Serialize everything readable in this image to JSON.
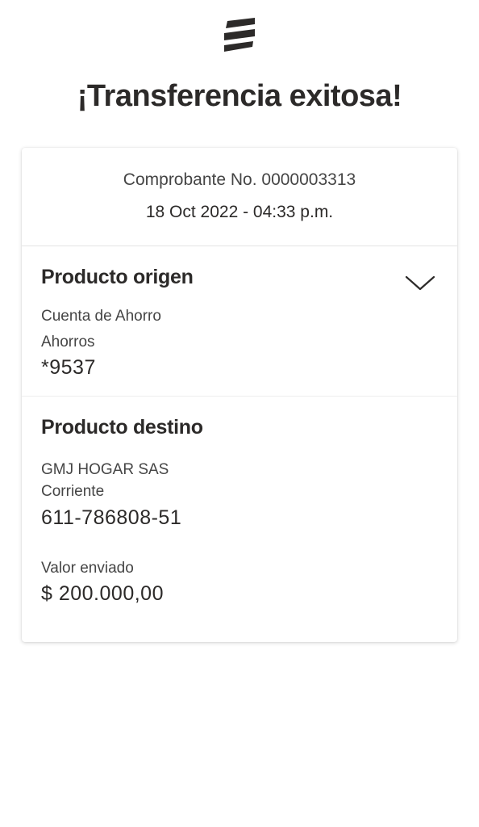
{
  "header": {
    "logo_icon": "bancolombia-logo-icon",
    "title": "¡Transferencia exitosa!"
  },
  "receipt": {
    "number": "Comprobante No. 0000003313",
    "datetime": "18 Oct 2022 - 04:33 p.m."
  },
  "origin": {
    "title": "Producto origen",
    "toggle_icon": "chevron-down-icon",
    "account_name": "Cuenta de Ahorro",
    "account_type": "Ahorros",
    "account_number": "*9537"
  },
  "destination": {
    "title": "Producto destino",
    "account_name": "GMJ HOGAR SAS",
    "account_type": "Corriente",
    "account_number": "611-786808-51",
    "amount_label": "Valor enviado",
    "amount_value": "$ 200.000,00"
  },
  "colors": {
    "text_primary": "#2c2a29",
    "text_secondary": "#454545",
    "background": "#ffffff"
  }
}
